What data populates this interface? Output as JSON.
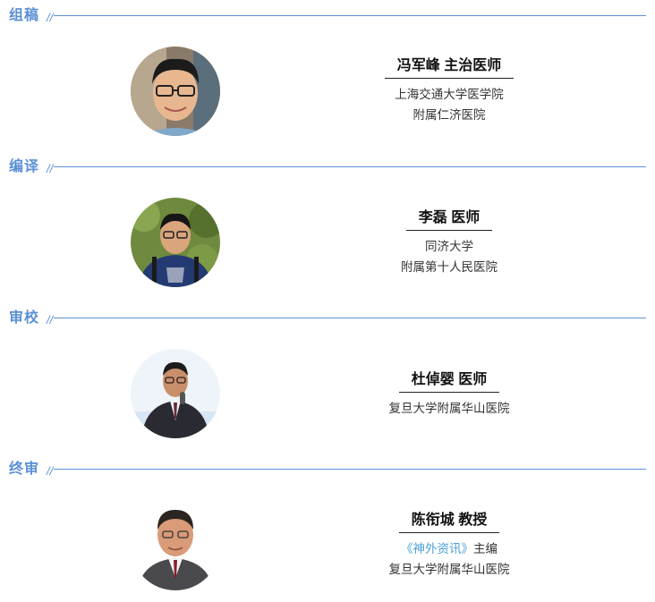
{
  "sections": [
    {
      "title": "组稿",
      "name": "冯军峰 主治医师",
      "lines": [
        "上海交通大学医学院",
        "附属仁济医院"
      ]
    },
    {
      "title": "编译",
      "name": "李磊 医师",
      "lines": [
        "同济大学",
        "附属第十人民医院"
      ]
    },
    {
      "title": "审校",
      "name": "杜倬婴 医师",
      "lines": [
        "复旦大学附属华山医院"
      ]
    },
    {
      "title": "终审",
      "name": "陈衔城 教授",
      "journal": "《神外资讯》",
      "journal_role": "主编",
      "lines": [
        "复旦大学附属华山医院"
      ]
    }
  ],
  "slash_glyph": "//",
  "colors": {
    "accent": "#5b8fd6",
    "highlight": "#4aa0d9"
  }
}
